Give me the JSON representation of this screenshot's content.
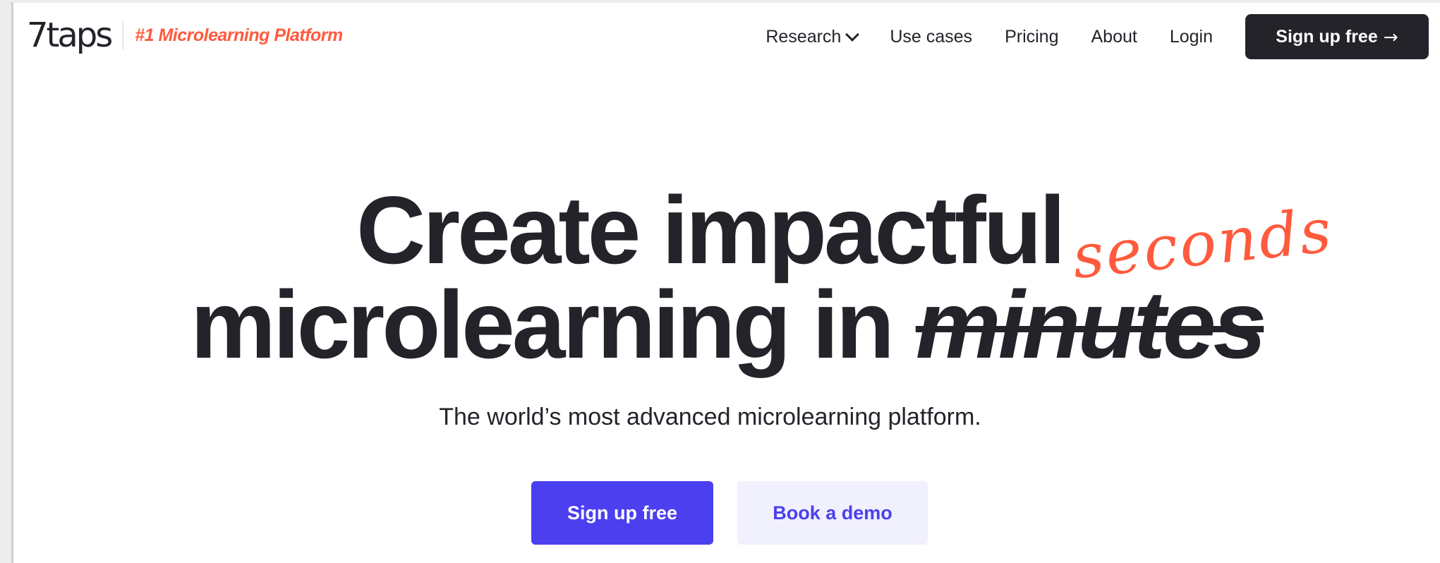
{
  "brand": {
    "logo": "7taps",
    "tagline": "#1 Microlearning Platform"
  },
  "nav": {
    "items": [
      {
        "label": "Research",
        "has_dropdown": true
      },
      {
        "label": "Use cases"
      },
      {
        "label": "Pricing"
      },
      {
        "label": "About"
      },
      {
        "label": "Login"
      }
    ],
    "cta_label": "Sign up free",
    "cta_icon": "arrow-right-icon"
  },
  "hero": {
    "line1": "Create impactful",
    "line2_prefix": "microlearning in ",
    "struck_word": "minutes",
    "handwritten_word": "seconds",
    "subtitle": "The world’s most advanced microlearning platform."
  },
  "cta": {
    "primary_label": "Sign up free",
    "secondary_label": "Book a demo"
  },
  "colors": {
    "accent": "#ff5a3d",
    "primary": "#4b3ff0",
    "dark": "#24232a",
    "secondary_bg": "#f1f0fd"
  }
}
